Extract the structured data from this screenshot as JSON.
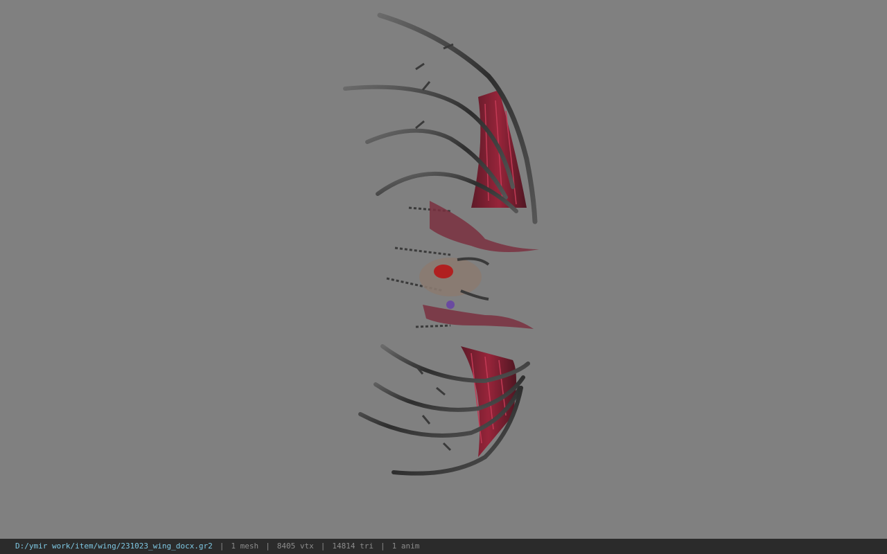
{
  "viewport": {
    "background_color": "#808080",
    "model_name": "wing model"
  },
  "status_bar": {
    "file_path": "D:/ymir work/item/wing/231023_wing_docx.gr2",
    "mesh_count": "1 mesh",
    "vertex_count": "8405 vtx",
    "triangle_count": "14814 tri",
    "anim_count": "1 anim",
    "separator": "|",
    "path_color": "#7ec8e3",
    "text_color": "#8c8c8c",
    "bar_color": "#2b2b2b"
  }
}
